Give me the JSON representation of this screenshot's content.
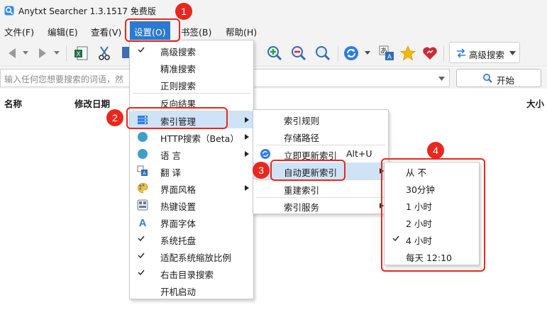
{
  "window": {
    "title": "Anytxt Searcher 1.3.1517 免费版"
  },
  "menubar": {
    "items": [
      {
        "label": "文件(F)"
      },
      {
        "label": "编辑(E)"
      },
      {
        "label": "查看(V)"
      },
      {
        "label": "设置(O)"
      },
      {
        "label": "书签(B)"
      },
      {
        "label": "帮助(H)"
      }
    ]
  },
  "toolbar": {
    "advanced_search_label": "高级搜索",
    "icons": [
      "back-icon",
      "forward-icon",
      "excel-export-icon",
      "cut-icon",
      "copy-icon",
      "zoom-in-icon",
      "zoom-out-icon",
      "zoom-reset-icon",
      "refresh-icon",
      "translate-icon",
      "star-icon",
      "heart-icon",
      "advanced-search-icon"
    ]
  },
  "search": {
    "placeholder": "输入任何您想要搜索的词语，然",
    "start_label": "开始"
  },
  "results": {
    "columns": {
      "name": "名称",
      "modified": "修改日期",
      "size": "大小"
    }
  },
  "settings_menu": {
    "items": [
      {
        "label": "高级搜索",
        "checked": true
      },
      {
        "label": "精准搜索",
        "checked": false
      },
      {
        "label": "正则搜索",
        "checked": false
      },
      {
        "label": "反向结果",
        "checked": false
      },
      {
        "label": "索引管理",
        "icon": "index-icon",
        "submenu": true,
        "highlighted": true
      },
      {
        "label": "HTTP搜索（Beta）",
        "icon": "globe-icon",
        "submenu": true
      },
      {
        "label": "语  言",
        "icon": "globe-icon",
        "submenu": true
      },
      {
        "label": "翻  译",
        "icon": "translate-icon"
      },
      {
        "label": "界面风格",
        "icon": "palette-icon",
        "submenu": true
      },
      {
        "label": "热键设置",
        "icon": "hotkey-icon"
      },
      {
        "label": "界面字体",
        "icon": "font-icon"
      },
      {
        "label": "系统托盘",
        "checked": true
      },
      {
        "label": "适配系统缩放比例",
        "checked": true
      },
      {
        "label": "右击目录搜索",
        "checked": true
      },
      {
        "label": "开机启动",
        "checked": false
      }
    ]
  },
  "index_menu": {
    "items": [
      {
        "label": "索引规则"
      },
      {
        "label": "存储路径"
      },
      {
        "label": "立即更新索引",
        "shortcut": "Alt+U",
        "icon": "refresh-icon"
      },
      {
        "label": "自动更新索引",
        "submenu": true,
        "highlighted": true
      },
      {
        "label": "重建索引"
      },
      {
        "label": "索引服务",
        "submenu": true
      }
    ]
  },
  "auto_update_menu": {
    "items": [
      {
        "label": "从 不",
        "checked": false
      },
      {
        "label": "30分钟",
        "checked": false
      },
      {
        "label": "1 小时",
        "checked": false
      },
      {
        "label": "2 小时",
        "checked": false
      },
      {
        "label": "4 小时",
        "checked": true
      },
      {
        "label": "每天 12:10",
        "checked": false
      }
    ]
  },
  "annotations": {
    "steps": [
      "1",
      "2",
      "3",
      "4"
    ],
    "color": "#e8281e"
  },
  "colors": {
    "accent": "#2b79d0",
    "highlight": "#cfe3f7",
    "annotation": "#e8281e"
  }
}
